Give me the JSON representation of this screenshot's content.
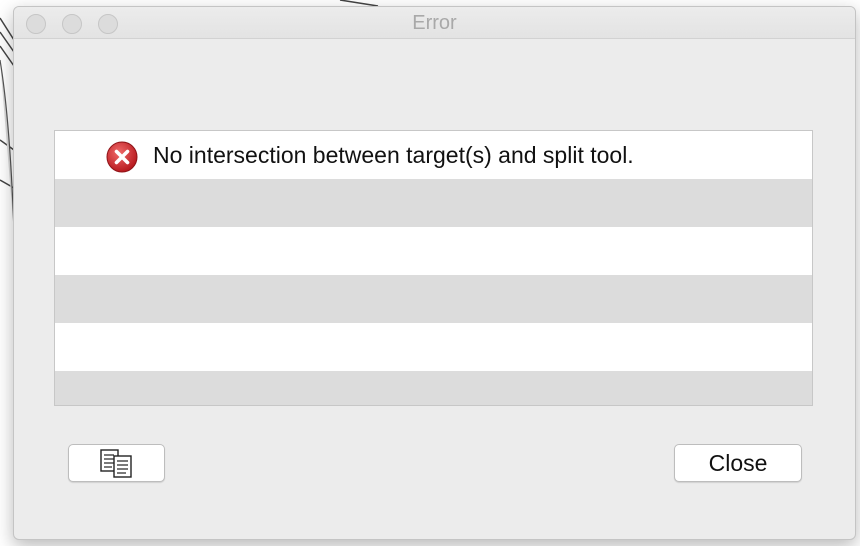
{
  "window": {
    "title": "Error"
  },
  "traffic_lights": {
    "close": "close-button",
    "minimize": "minimize-button",
    "zoom": "zoom-button"
  },
  "messages": [
    {
      "icon": "error-icon",
      "text": "No intersection between target(s) and split tool."
    }
  ],
  "buttons": {
    "copy_icon": "copy-to-clipboard-icon",
    "close_label": "Close"
  },
  "colors": {
    "error_red": "#d0252a",
    "row_stripe": "#dcdcdc",
    "window_bg": "#ececec"
  }
}
